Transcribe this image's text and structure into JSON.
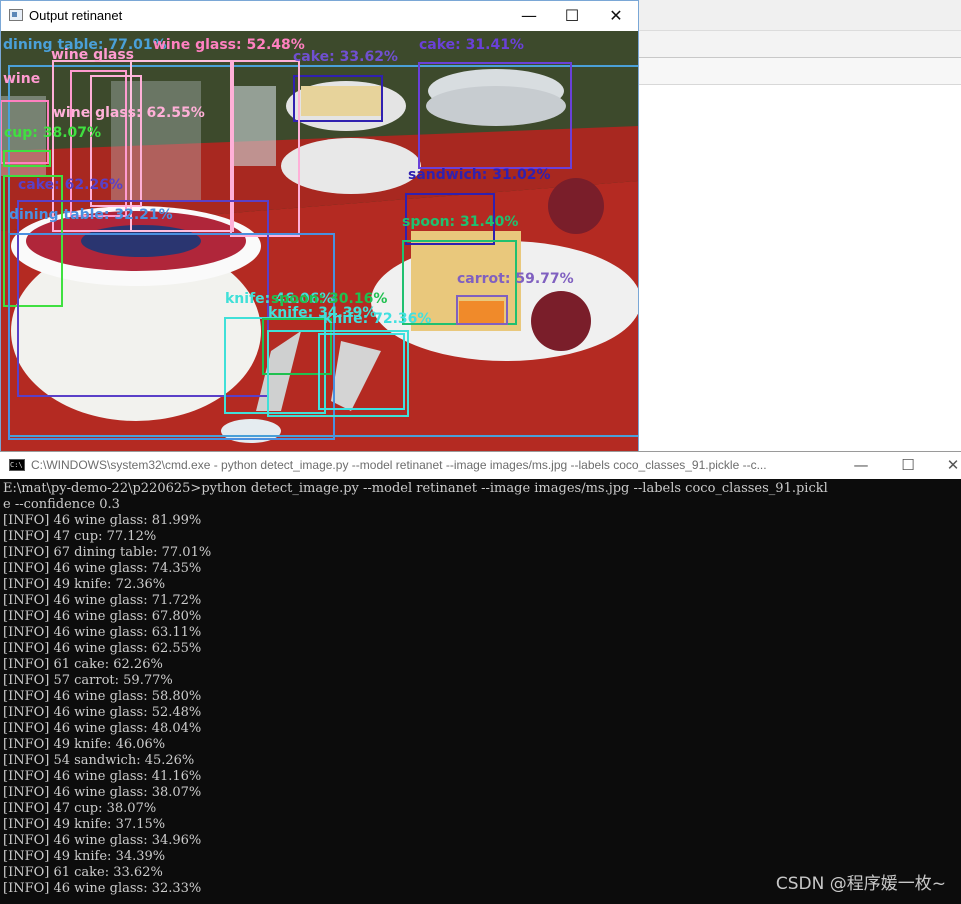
{
  "output_window": {
    "title": "Output retinanet",
    "buttons": {
      "minimize": "—",
      "maximize": "☐",
      "close": "✕"
    },
    "detections": [
      {
        "label": "dining table: 77.01%",
        "color": "#4aa0d8"
      },
      {
        "label": "wine glass: 52.48%",
        "color": "#ff80c0"
      },
      {
        "label": "cake: 33.62%",
        "color": "#7050d0"
      },
      {
        "label": "cake: 31.41%",
        "color": "#6a40d8"
      },
      {
        "label": "wine glass",
        "color": "#ff9bd0"
      },
      {
        "label": "wine",
        "color": "#ff9bd0"
      },
      {
        "label": "cup: 38.07%",
        "color": "#40e040"
      },
      {
        "label": "wine glass: 62.55%",
        "color": "#ffb0d8"
      },
      {
        "label": "sandwich: 31.02%",
        "color": "#3020b0"
      },
      {
        "label": "cake: 62.26%",
        "color": "#5a40c8"
      },
      {
        "label": "dining table: 32.21%",
        "color": "#4a90e0"
      },
      {
        "label": "spoon: 31.40%",
        "color": "#20c070"
      },
      {
        "label": "carrot: 59.77%",
        "color": "#8060c0"
      },
      {
        "label": "knife: 46.06%",
        "color": "#40e0d8"
      },
      {
        "label": "spoon: 30.16%",
        "color": "#20c050"
      },
      {
        "label": "knife: 34.39%",
        "color": "#40e0d8"
      },
      {
        "label": "knife: 72.36%",
        "color": "#40e0e0"
      }
    ]
  },
  "cmd_window": {
    "title": "C:\\WINDOWS\\system32\\cmd.exe - python  detect_image.py --model retinanet --image images/ms.jpg --labels coco_classes_91.pickle --c...",
    "buttons": {
      "minimize": "—",
      "maximize": "☐",
      "close": "✕"
    },
    "lines": [
      "E:\\mat\\py-demo-22\\p220625>python detect_image.py --model retinanet --image images/ms.jpg --labels coco_classes_91.pickl",
      "e --confidence 0.3",
      "[INFO] 46 wine glass: 81.99%",
      "[INFO] 47 cup: 77.12%",
      "[INFO] 67 dining table: 77.01%",
      "[INFO] 46 wine glass: 74.35%",
      "[INFO] 49 knife: 72.36%",
      "[INFO] 46 wine glass: 71.72%",
      "[INFO] 46 wine glass: 67.80%",
      "[INFO] 46 wine glass: 63.11%",
      "[INFO] 46 wine glass: 62.55%",
      "[INFO] 61 cake: 62.26%",
      "[INFO] 57 carrot: 59.77%",
      "[INFO] 46 wine glass: 58.80%",
      "[INFO] 46 wine glass: 52.48%",
      "[INFO] 46 wine glass: 48.04%",
      "[INFO] 49 knife: 46.06%",
      "[INFO] 54 sandwich: 45.26%",
      "[INFO] 46 wine glass: 41.16%",
      "[INFO] 46 wine glass: 38.07%",
      "[INFO] 47 cup: 38.07%",
      "[INFO] 49 knife: 37.15%",
      "[INFO] 46 wine glass: 34.96%",
      "[INFO] 49 knife: 34.39%",
      "[INFO] 61 cake: 33.62%",
      "[INFO] 46 wine glass: 32.33%"
    ]
  },
  "watermark": "CSDN @程序媛一枚~"
}
